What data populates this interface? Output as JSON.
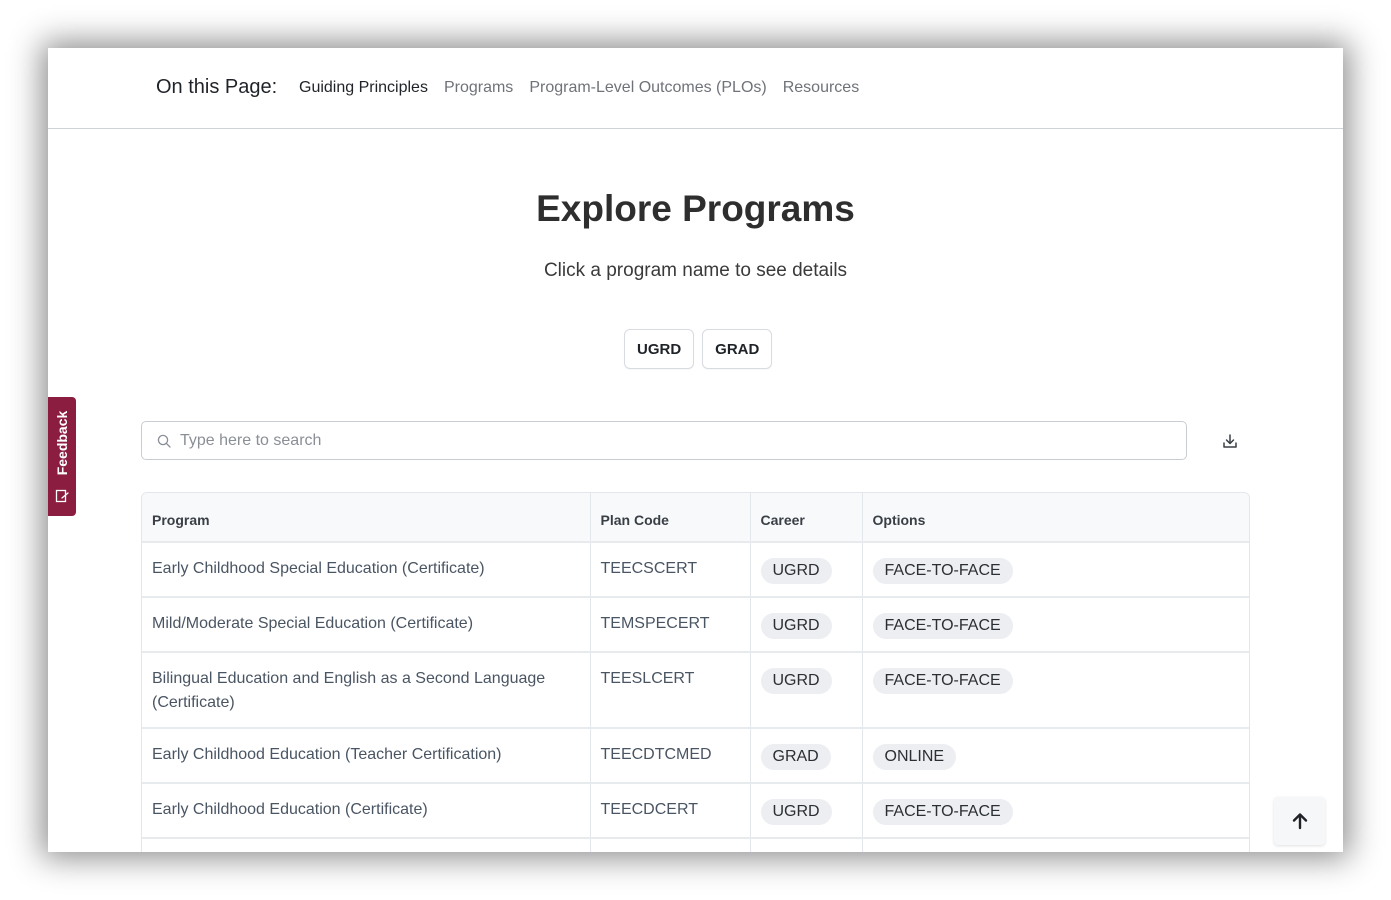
{
  "on_this_page": {
    "label": "On this Page:",
    "links": [
      {
        "label": "Guiding Principles",
        "active": true
      },
      {
        "label": "Programs",
        "active": false
      },
      {
        "label": "Program-Level Outcomes (PLOs)",
        "active": false
      },
      {
        "label": "Resources",
        "active": false
      }
    ]
  },
  "main": {
    "title": "Explore Programs",
    "subtitle": "Click a program name to see details",
    "career_filters": [
      "UGRD",
      "GRAD"
    ]
  },
  "search": {
    "placeholder": "Type here to search",
    "value": ""
  },
  "table": {
    "headers": [
      "Program",
      "Plan Code",
      "Career",
      "Options"
    ],
    "rows": [
      {
        "program": "Early Childhood Special Education (Certificate)",
        "plan_code": "TEECSCERT",
        "career": "UGRD",
        "options": "FACE-TO-FACE"
      },
      {
        "program": "Mild/Moderate Special Education (Certificate)",
        "plan_code": "TEMSPECERT",
        "career": "UGRD",
        "options": "FACE-TO-FACE"
      },
      {
        "program": "Bilingual Education and English as a Second Language (Certificate)",
        "plan_code": "TEESLCERT",
        "career": "UGRD",
        "options": "FACE-TO-FACE"
      },
      {
        "program": "Early Childhood Education (Teacher Certification)",
        "plan_code": "TEECDTCMED",
        "career": "GRAD",
        "options": "ONLINE"
      },
      {
        "program": "Early Childhood Education (Certificate)",
        "plan_code": "TEECDCERT",
        "career": "UGRD",
        "options": "FACE-TO-FACE"
      }
    ]
  },
  "feedback": {
    "label": "Feedback"
  },
  "icons": {
    "search": "search-icon",
    "download": "download-icon",
    "feedback": "edit-icon",
    "back_to_top": "arrow-up-icon"
  },
  "colors": {
    "feedback_tab": "#8a1d40",
    "pill_bg": "#eceef1"
  }
}
